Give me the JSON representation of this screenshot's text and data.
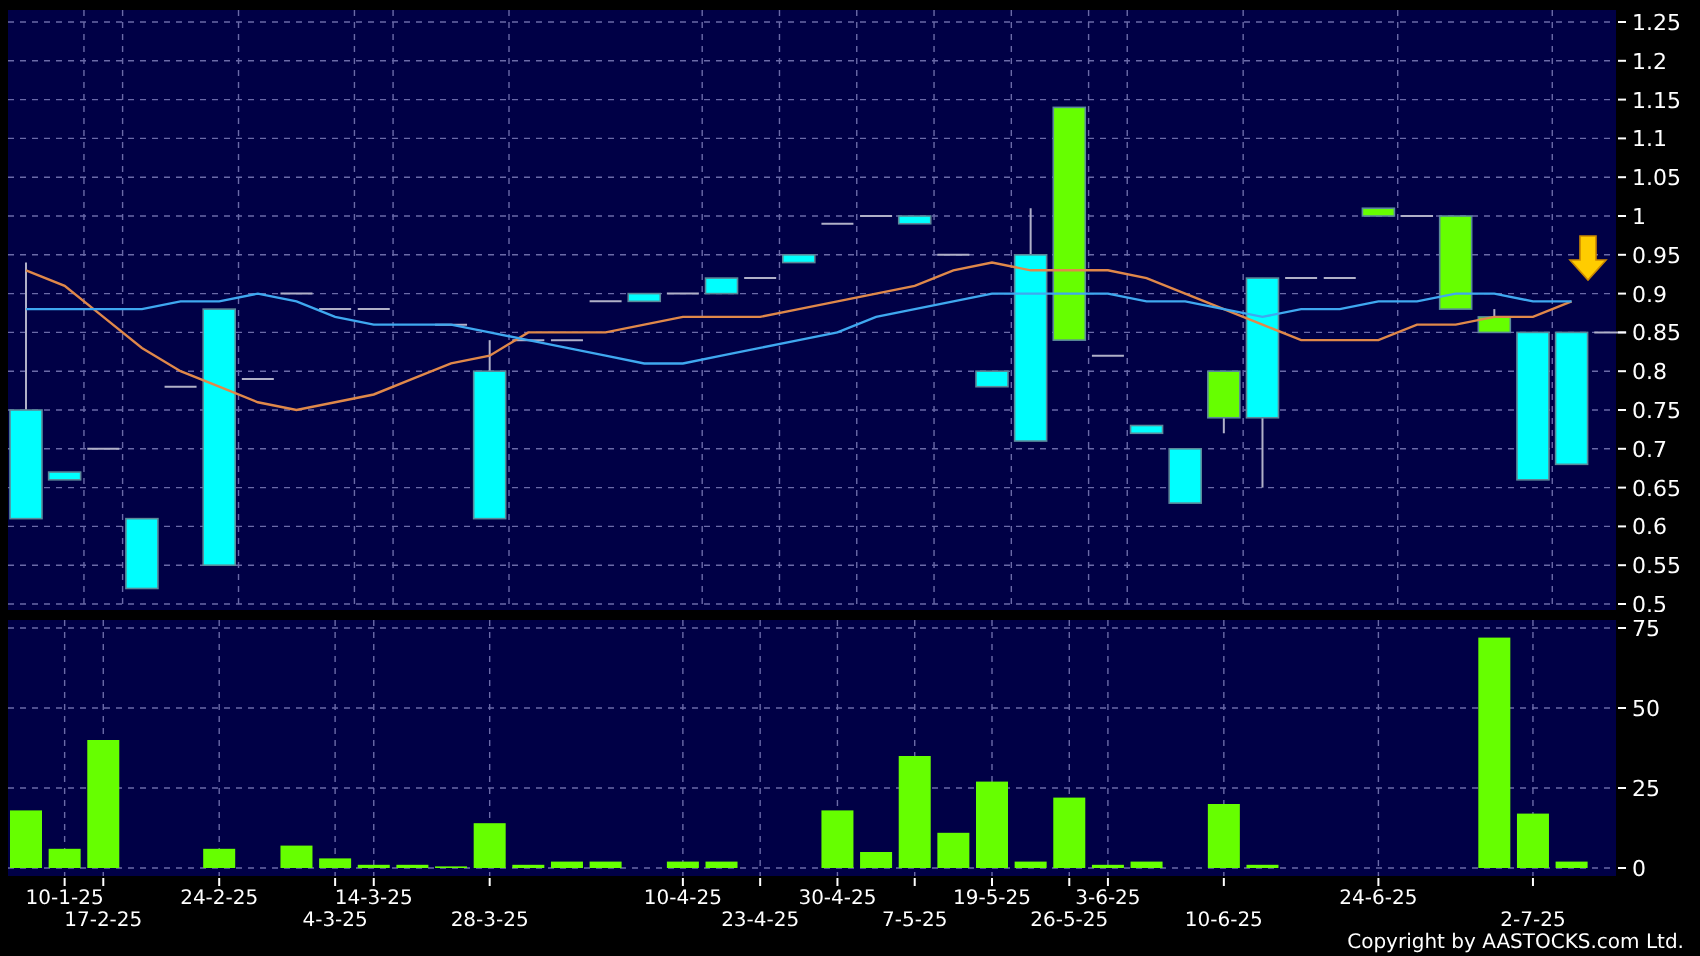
{
  "price_chart": {
    "chart_data": {
      "type": "line",
      "ylim": [
        0.5,
        1.25
      ],
      "yticks": [
        0.5,
        0.55,
        0.6,
        0.65,
        0.7,
        0.75,
        0.8,
        0.85,
        0.9,
        0.95,
        1,
        1.05,
        1.1,
        1.15,
        1.2,
        1.25
      ],
      "grid": true,
      "series": [
        {
          "color": "#e0884a",
          "values": [
            0.93,
            0.91,
            0.87,
            0.83,
            0.8,
            0.78,
            0.76,
            0.75,
            0.76,
            0.77,
            0.79,
            0.81,
            0.82,
            0.85,
            0.85,
            0.85,
            0.86,
            0.87,
            0.87,
            0.87,
            0.88,
            0.89,
            0.9,
            0.91,
            0.93,
            0.94,
            0.93,
            0.93,
            0.93,
            0.92,
            0.9,
            0.88,
            0.86,
            0.84,
            0.84,
            0.84,
            0.86,
            0.86,
            0.87,
            0.87,
            0.89,
            null
          ]
        },
        {
          "color": "#3fa8f0",
          "values": [
            0.88,
            0.88,
            0.88,
            0.88,
            0.89,
            0.89,
            0.9,
            0.89,
            0.87,
            0.86,
            0.86,
            0.86,
            0.85,
            0.84,
            0.83,
            0.82,
            0.81,
            0.81,
            0.82,
            0.83,
            0.84,
            0.85,
            0.87,
            0.88,
            0.89,
            0.9,
            0.9,
            0.9,
            0.9,
            0.89,
            0.89,
            0.88,
            0.87,
            0.88,
            0.88,
            0.89,
            0.89,
            0.9,
            0.9,
            0.89,
            0.89,
            null
          ]
        }
      ]
    }
  },
  "volume_chart": {
    "chart_data": {
      "type": "bar",
      "ylim": [
        0,
        75
      ],
      "yticks": [
        0,
        25,
        50,
        75
      ],
      "grid": true,
      "categories": [
        null,
        "10-1-25",
        "17-2-25",
        null,
        null,
        "24-2-25",
        null,
        null,
        "4-3-25",
        "14-3-25",
        null,
        null,
        "28-3-25",
        null,
        null,
        null,
        null,
        "10-4-25",
        null,
        "23-4-25",
        null,
        "30-4-25",
        null,
        "7-5-25",
        null,
        "19-5-25",
        null,
        "26-5-25",
        "3-6-25",
        null,
        null,
        "10-6-25",
        null,
        null,
        null,
        "24-6-25",
        null,
        null,
        null,
        "2-7-25",
        null,
        null
      ],
      "series": [
        {
          "color": "#66ff00",
          "values": [
            18,
            6,
            40,
            0,
            0,
            6,
            0,
            7,
            3,
            1,
            1,
            0.5,
            14,
            1,
            2,
            2,
            0,
            2,
            2,
            0,
            0,
            18,
            5,
            35,
            11,
            27,
            2,
            22,
            1,
            2,
            0,
            20,
            1,
            0,
            0,
            0,
            0,
            0,
            72,
            17,
            2,
            0
          ]
        }
      ]
    }
  },
  "copyright": "Copyright by AASTOCKS.com Ltd."
}
